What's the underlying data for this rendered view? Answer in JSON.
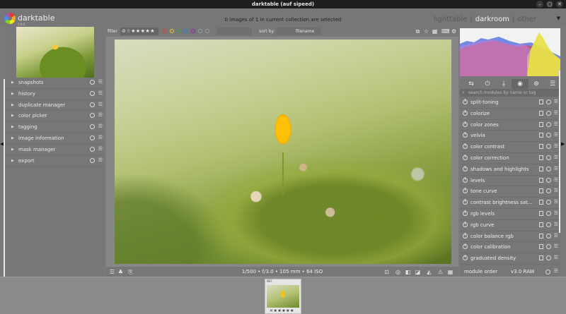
{
  "window": {
    "title": "darktable (auf sipeed)",
    "min_label": "–",
    "max_label": "▢",
    "close_label": "✕"
  },
  "header": {
    "app_name": "darktable",
    "version": "3.0.0",
    "selection_info": "0 images of 1 in current collection are selected",
    "views": {
      "lighttable": "lighttable",
      "darkroom": "darkroom",
      "other": "other",
      "separator": "|"
    },
    "active_view": "darkroom",
    "collapse_icon": "▼"
  },
  "filter_bar": {
    "filter_label": "filter",
    "stars_value": "⊘☆★★★★★",
    "color_labels": [
      "#e53935",
      "#fbc02d",
      "#43a047",
      "#1e88e5",
      "#8e24aa",
      "#9e9e9e",
      "#9e9e9e"
    ],
    "sort_label": "sort by",
    "sort_value": "filename",
    "sort_arrow": "⌄"
  },
  "left_panel": {
    "modules": [
      {
        "label": "snapshots"
      },
      {
        "label": "history"
      },
      {
        "label": "duplicate manager"
      },
      {
        "label": "color picker"
      },
      {
        "label": "tagging"
      },
      {
        "label": "image information"
      },
      {
        "label": "mask manager"
      },
      {
        "label": "export"
      }
    ],
    "arrow_glyph": "▶",
    "menu_glyph": "☰"
  },
  "image": {
    "exif": "1/500 • f/3.0 • 105 mm • 64 ISO"
  },
  "right_panel": {
    "histogram_colors": {
      "red": "#e0463c",
      "blue": "#5a78e0",
      "yellow": "#e8e04a",
      "magenta": "#c880d8"
    },
    "tabs": [
      "⇆",
      "⏻",
      "⤓",
      "◉",
      "⊛",
      "☰"
    ],
    "search_placeholder": "search modules by name or tag",
    "modules": [
      {
        "label": "split-toning"
      },
      {
        "label": "colorize"
      },
      {
        "label": "color zones"
      },
      {
        "label": "velvia"
      },
      {
        "label": "color contrast"
      },
      {
        "label": "color correction"
      },
      {
        "label": "shadows and highlights"
      },
      {
        "label": "levels"
      },
      {
        "label": "tone curve"
      },
      {
        "label": "contrast brightness saturation"
      },
      {
        "label": "rgb levels"
      },
      {
        "label": "rgb curve"
      },
      {
        "label": "color balance rgb"
      },
      {
        "label": "color calibration"
      },
      {
        "label": "graduated density"
      }
    ],
    "module_order_label": "module order",
    "module_order_value": "v3.0 RAW"
  },
  "filmstrip": {
    "ext_label": "NEF",
    "stars": "✕★★★★★"
  }
}
